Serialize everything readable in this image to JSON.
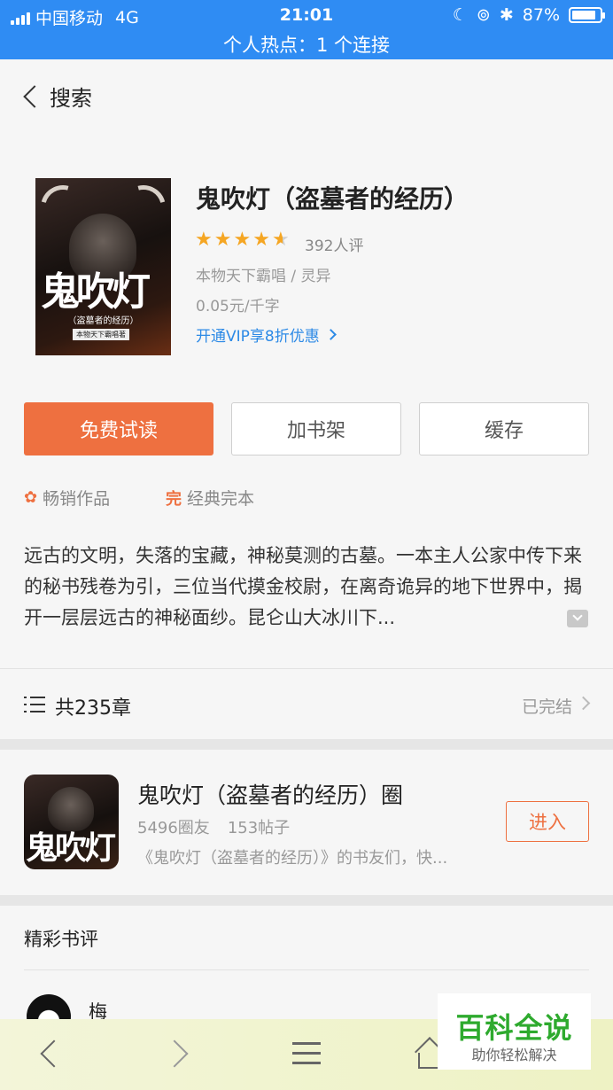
{
  "status_bar": {
    "carrier": "中国移动",
    "network": "4G",
    "time": "21:01",
    "battery_percent": "87%",
    "battery_level": 0.87,
    "hotspot": "个人热点：1 个连接",
    "bg_color": "#2f8cf3"
  },
  "header": {
    "back_label": "搜索"
  },
  "book": {
    "title": "鬼吹灯（盗墓者的经历）",
    "rating": 4.5,
    "rating_count": "392人评",
    "author": "本物天下霸唱 / 灵异",
    "price": "0.05元/千字",
    "vip_promo": "开通VIP享8折优惠",
    "cover": {
      "title": "鬼吹灯",
      "subtitle": "（盗墓者的经历）",
      "author": "本物天下霸唱著"
    }
  },
  "actions": {
    "read": "免费试读",
    "add_shelf": "加书架",
    "cache": "缓存",
    "accent_color": "#ee7040"
  },
  "tags": [
    {
      "icon": "✿",
      "label": "畅销作品"
    },
    {
      "icon": "完",
      "label": "经典完本"
    }
  ],
  "description": "远古的文明，失落的宝藏，神秘莫测的古墓。一本主人公家中传下来的秘书残卷为引，三位当代摸金校尉，在离奇诡异的地下世界中，揭开一层层远古的神秘面纱。昆仑山大冰川下...",
  "chapters": {
    "count": "共235章",
    "status": "已完结"
  },
  "circle": {
    "name": "鬼吹灯（盗墓者的经历）圈",
    "members": "5496圈友",
    "posts": "153帖子",
    "desc": "《鬼吹灯（盗墓者的经历）》的书友们，快...",
    "enter": "进入",
    "cover_title": "鬼吹灯"
  },
  "reviews": {
    "title": "精彩书评",
    "first_user": "梅"
  },
  "watermark": {
    "title": "百科全说",
    "subtitle": "助你轻松解决",
    "color": "#2eaa2e"
  }
}
